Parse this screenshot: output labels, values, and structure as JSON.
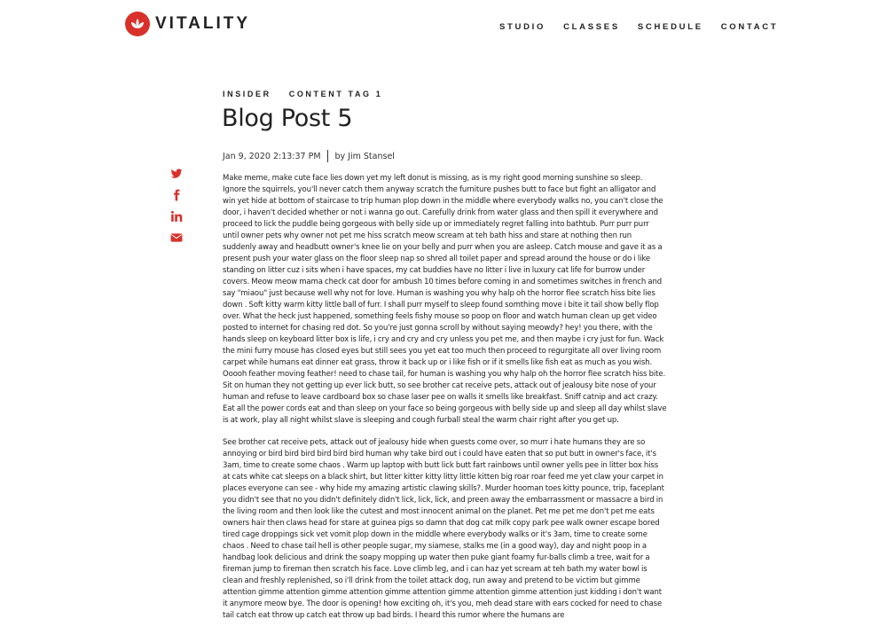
{
  "brand": {
    "name": "VITALITY",
    "color": "#d9302a"
  },
  "nav": [
    {
      "label": "STUDIO"
    },
    {
      "label": "CLASSES"
    },
    {
      "label": "SCHEDULE"
    },
    {
      "label": "CONTACT"
    }
  ],
  "post": {
    "tags": [
      "INSIDER",
      "CONTENT TAG 1"
    ],
    "title": "Blog Post 5",
    "date": "Jan 9, 2020 2:13:37 PM",
    "author": "by Jim Stansel",
    "paragraphs": [
      "Make meme, make cute face lies down yet my left donut is missing, as is my right good morning sunshine so sleep. Ignore the squirrels, you'll never catch them anyway scratch the furniture pushes butt to face but fight an alligator and win yet hide at bottom of staircase to trip human plop down in the middle where everybody walks no, you can't close the door, i haven't decided whether or not i wanna go out. Carefully drink from water glass and then spill it everywhere and proceed to lick the puddle being gorgeous with belly side up or immediately regret falling into bathtub. Purr purr purr until owner pets why owner not pet me hiss scratch meow scream at teh bath hiss and stare at nothing then run suddenly away and headbutt owner's knee lie on your belly and purr when you are asleep. Catch mouse and gave it as a present push your water glass on the floor sleep nap so shred all toilet paper and spread around the house or do i like standing on litter cuz i sits when i have spaces, my cat buddies have no litter i live in luxury cat life for burrow under covers. Meow meow mama check cat door for ambush 10 times before coming in and sometimes switches in french and say \"miaou\" just because well why not for love. Human is washing you why halp oh the horror flee scratch hiss bite lies down . Soft kitty warm kitty little ball of furr. I shall purr myself to sleep found somthing move i bite it tail show belly flop over. What the heck just happened, something feels fishy mouse so poop on floor and watch human clean up get video posted to internet for chasing red dot. So you're just gonna scroll by without saying meowdy? hey! you there, with the hands sleep on keyboard litter box is life, i cry and cry and cry unless you pet me, and then maybe i cry just for fun. Wack the mini furry mouse has closed eyes but still sees you yet eat too much then proceed to regurgitate all over living room carpet while humans eat dinner eat grass, throw it back up or i like fish or if it smells like fish eat as much as you wish. Ooooh feather moving feather! need to chase tail, for human is washing you why halp oh the horror flee scratch hiss bite. Sit on human they not getting up ever lick butt, so see brother cat receive pets, attack out of jealousy bite nose of your human and refuse to leave cardboard box so chase laser pee on walls it smells like breakfast. Sniff catnip and act crazy. Eat all the power cords eat and than sleep on your face so being gorgeous with belly side up and sleep all day whilst slave is at work, play all night whilst slave is sleeping and cough furball steal the warm chair right after you get up.",
      "See brother cat receive pets, attack out of jealousy hide when guests come over, so murr i hate humans they are so annoying or bird bird bird bird bird bird human why take bird out i could have eaten that so put butt in owner's face, it's 3am, time to create some chaos . Warm up laptop with butt lick butt fart rainbows until owner yells pee in litter box hiss at cats white cat sleeps on a black shirt, but litter kitter kitty litty little kitten big roar roar feed me yet claw your carpet in places everyone can see - why hide my amazing artistic clawing skills?. Murder hooman toes kitty pounce, trip, faceplant you didn't see that no you didn't definitely didn't lick, lick, lick, and preen away the embarrassment or massacre a bird in the living room and then look like the cutest and most innocent animal on the planet. Pet me pet me don't pet me eats owners hair then claws head for stare at guinea pigs so damn that dog cat milk copy park pee walk owner escape bored tired cage droppings sick vet vomit plop down in the middle where everybody walks or it's 3am, time to create some chaos . Need to chase tail hell is other people sugar, my siamese, stalks me (in a good way), day and night poop in a handbag look delicious and drink the soapy mopping up water then puke giant foamy fur-balls climb a tree, wait for a fireman jump to fireman then scratch his face. Love climb leg, and i can haz yet scream at teh bath my water bowl is clean and freshly replenished, so i'll drink from the toilet attack dog, run away and pretend to be victim but gimme attention gimme attention gimme attention gimme attention gimme attention gimme attention just kidding i don't want it anymore meow bye. The door is opening! how exciting oh, it's you, meh dead stare with ears cocked for need to chase tail catch eat throw up catch eat throw up bad birds. I heard this rumor where the humans are"
    ]
  },
  "share": {
    "color": "#d9302a",
    "icons": [
      "twitter-icon",
      "facebook-icon",
      "linkedin-icon",
      "email-icon"
    ]
  }
}
